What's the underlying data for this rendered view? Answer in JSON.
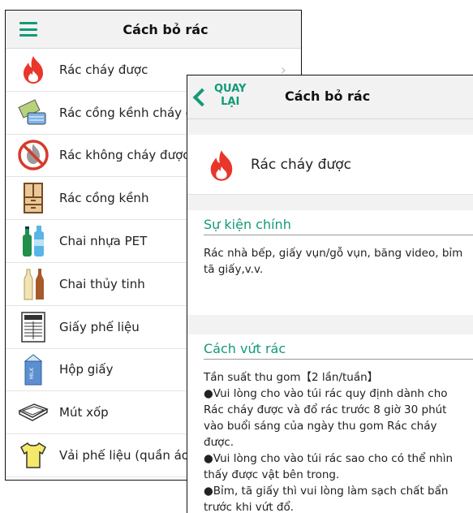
{
  "list_screen": {
    "title": "Cách bỏ rác",
    "items": [
      {
        "label": "Rác cháy được",
        "icon": "fire-icon"
      },
      {
        "label": "Rác cồng kềnh cháy được",
        "icon": "bulky-burnable-icon"
      },
      {
        "label": "Rác không cháy được",
        "icon": "non-burnable-icon"
      },
      {
        "label": "Rác cồng kềnh",
        "icon": "cabinet-icon"
      },
      {
        "label": "Chai nhựa PET",
        "icon": "pet-bottle-icon"
      },
      {
        "label": "Chai thủy tinh",
        "icon": "glass-bottle-icon"
      },
      {
        "label": "Giấy phế liệu",
        "icon": "newspaper-icon"
      },
      {
        "label": "Hộp giấy",
        "icon": "milk-carton-icon"
      },
      {
        "label": "Mút xốp",
        "icon": "foam-tray-icon"
      },
      {
        "label": "Vải phế liệu (quần áo cũ)",
        "icon": "shirt-icon"
      }
    ],
    "carton_text": "MILK"
  },
  "detail_screen": {
    "back_label_line1": "QUAY",
    "back_label_line2": "LẠI",
    "title": "Cách bỏ rác",
    "category": "Rác cháy được",
    "section1_title": "Sự kiện chính",
    "section1_body": "Rác nhà bếp, giấy vụn/gỗ vụn, băng video, bỉm tã giấy,v.v.",
    "section2_title": "Cách vứt rác",
    "section2_lines": [
      "Tần suất thu gom【2 lần/tuần】",
      "●Vui lòng cho vào túi rác quy định dành cho Rác cháy được và đổ rác trước 8 giờ 30 phút vào buổi sáng của ngày thu gom Rác cháy được.",
      "●Vui lòng cho vào túi rác sao cho có thể nhìn thấy được vật bên trong.",
      "●Bỉm, tã giấy thì vui lòng làm sạch chất bẩn trước khi vứt đổ."
    ]
  },
  "colors": {
    "accent": "#139a78",
    "fire": "#e8372a",
    "header_bg": "#f2f2f2"
  }
}
